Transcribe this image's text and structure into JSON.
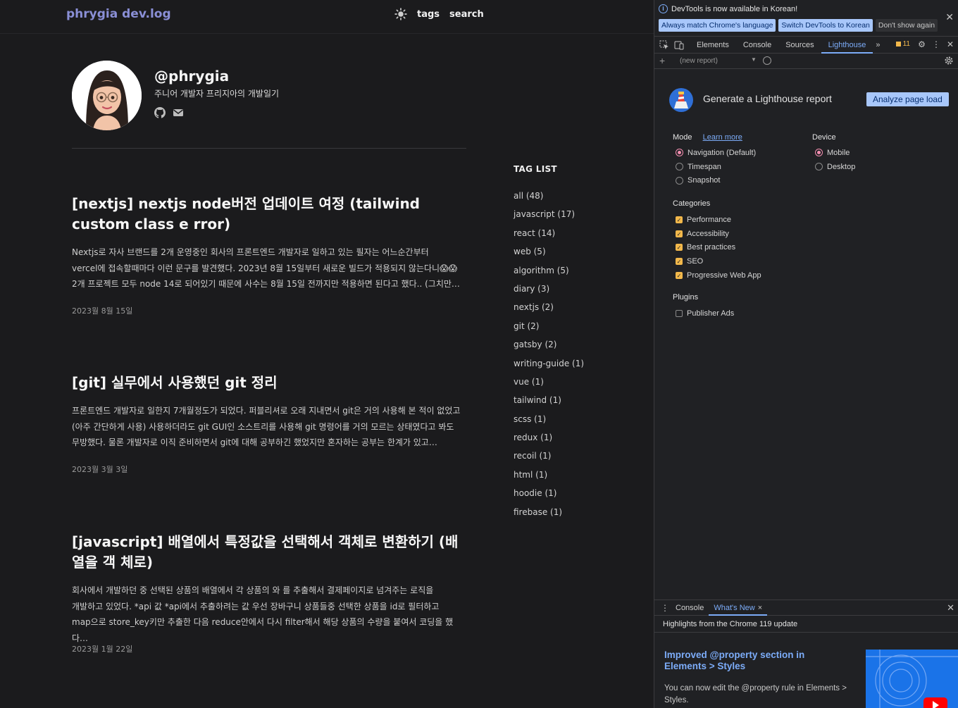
{
  "blog": {
    "logo": "phrygia dev.log",
    "nav": {
      "tags": "tags",
      "search": "search"
    },
    "profile": {
      "handle": "@phrygia",
      "intro": "주니어 개발자 프리지아의 개발일기"
    },
    "posts": [
      {
        "title": "[nextjs] nextjs node버전 업데이트 여정 (tailwind custom class e rror)",
        "excerpt_lines": [
          "Nextjs로 자사 브랜드를 2개 운영중인 회사의 프론트엔드 개발자로 일하고 있는 필자는 어느순간부터",
          "vercel에 접속할때마다 이런 문구를 발견했다. 2023년 8월 15일부터 새로운 빌드가 적용되지 않는다니😱😱",
          "2개 프로젝트 모두 node 14로 되어있기 때문에 사수는 8월 15일 전까지만 적용하면 된다고 했다.. (그치만…"
        ],
        "date": "2023월 8월 15일"
      },
      {
        "title": "[git] 실무에서 사용했던 git 정리",
        "excerpt_lines": [
          "프론트엔드 개발자로 일한지 7개월정도가 되었다. 퍼블리셔로 오래 지내면서 git은 거의 사용해 본 적이 없었고",
          "(아주 간단하게 사용) 사용하더라도 git GUI인 소스트리를 사용해 git 명령어를 거의 모르는 상태였다고 봐도",
          "무방했다. 물론 개발자로 이직 준비하면서 git에 대해 공부하긴 했었지만 혼자하는 공부는 한계가 있고…"
        ],
        "date": "2023월 3월 3일"
      },
      {
        "title": "[javascript] 배열에서 특정값을 선택해서 객체로 변환하기 (배열을 객 체로)",
        "excerpt_lines": [
          "회사에서 개발하던 중 선택된 상품의 배열에서 각 상품의 와 를 추출해서 결제페이지로 넘겨주는 로직을",
          "개발하고 있었다. *api 값 *api에서 추출하려는 값 우선 장바구니 상품들중 선택한 상품을 id로 필터하고",
          "map으로 store_key키만 추출한 다음 reduce안에서 다시 filter해서 해당 상품의 수량을 붙여서 코딩을 했다…"
        ],
        "date": "2023월 1월 22일"
      }
    ],
    "tag_list": {
      "title": "TAG LIST",
      "items": [
        "all (48)",
        "javascript (17)",
        "react (14)",
        "web (5)",
        "algorithm (5)",
        "diary (3)",
        "nextjs (2)",
        "git (2)",
        "gatsby (2)",
        "writing-guide (1)",
        "vue (1)",
        "tailwind (1)",
        "scss (1)",
        "redux (1)",
        "recoil (1)",
        "html (1)",
        "hoodie (1)",
        "firebase (1)"
      ]
    }
  },
  "devtools": {
    "infobar": {
      "message": "DevTools is now available in Korean!",
      "btn_match": "Always match Chrome's language",
      "btn_switch": "Switch DevTools to Korean",
      "btn_dismiss": "Don't show again"
    },
    "tabs": [
      "Elements",
      "Console",
      "Sources",
      "Lighthouse"
    ],
    "active_tab": "Lighthouse",
    "issues_count": "11",
    "report_select": "(new report)",
    "lighthouse": {
      "title": "Generate a Lighthouse report",
      "analyze_button": "Analyze page load",
      "mode_label": "Mode",
      "learn_more": "Learn more",
      "modes": [
        "Navigation (Default)",
        "Timespan",
        "Snapshot"
      ],
      "device_label": "Device",
      "devices": [
        "Mobile",
        "Desktop"
      ],
      "categories_label": "Categories",
      "categories": [
        "Performance",
        "Accessibility",
        "Best practices",
        "SEO",
        "Progressive Web App"
      ],
      "plugins_label": "Plugins",
      "plugins": [
        "Publisher Ads"
      ]
    },
    "drawer": {
      "tab_console": "Console",
      "tab_whats_new": "What's New",
      "highlights": "Highlights from the Chrome 119 update",
      "news_title": "Improved @property section in Elements > Styles",
      "news_body": "You can now edit the @property rule in Elements > Styles."
    },
    "colors": {
      "accent": "#7cacf8",
      "button_blue": "#a8c7fa",
      "checkbox": "#f2b84b",
      "radio": "#f48fb1",
      "logo": "#8a8fd6"
    }
  }
}
